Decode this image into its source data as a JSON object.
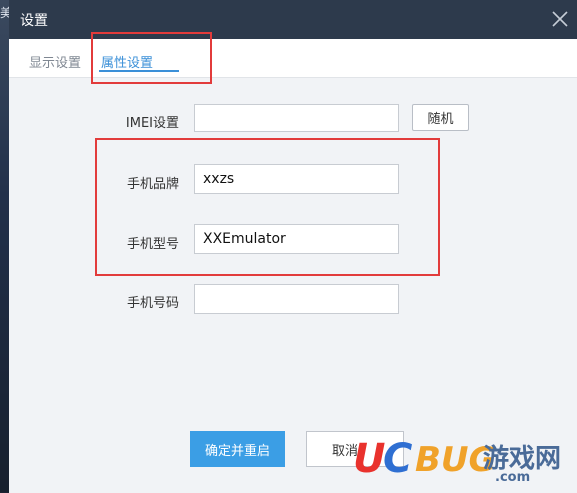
{
  "edge_glyph": "美",
  "dialog": {
    "title": "设置"
  },
  "tabs": [
    {
      "label": "显示设置",
      "active": false
    },
    {
      "label": "属性设置",
      "active": true
    }
  ],
  "form": {
    "imei": {
      "label": "IMEI设置",
      "value": ""
    },
    "random_label": "随机",
    "brand": {
      "label": "手机品牌",
      "value": "xxzs"
    },
    "model": {
      "label": "手机型号",
      "value": "XXEmulator"
    },
    "phone": {
      "label": "手机号码",
      "value": ""
    }
  },
  "buttons": {
    "confirm": "确定并重启",
    "cancel": "取消"
  },
  "watermark": {
    "brand_u": "U",
    "brand_c": "C",
    "brand_bug": "BUG",
    "brand_cn": "游戏网",
    "domain": ".com"
  },
  "colors": {
    "titlebar": "#2d3a4c",
    "accent": "#3b9ee5",
    "annotation": "#e23b3b"
  }
}
